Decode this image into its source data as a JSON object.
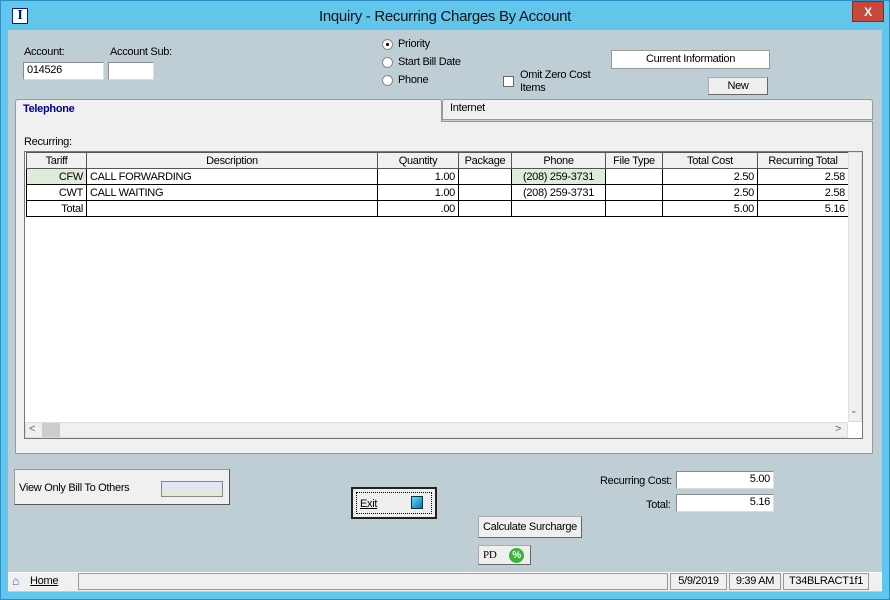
{
  "window": {
    "title": "Inquiry - Recurring Charges By Account",
    "close": "X",
    "app_icon": "I"
  },
  "form": {
    "account_label": "Account:",
    "account_value": "014526",
    "account_sub_label": "Account Sub:",
    "account_sub_value": "",
    "sort_options": [
      {
        "label": "Priority",
        "selected": true
      },
      {
        "label": "Start Bill Date",
        "selected": false
      },
      {
        "label": "Phone",
        "selected": false
      }
    ],
    "omit_zero_label": "Omit Zero Cost Items",
    "omit_zero_checked": false,
    "current_info": "Current Information",
    "new_button": "New"
  },
  "tabs": [
    {
      "label": "Telephone",
      "active": true
    },
    {
      "label": "Internet",
      "active": false
    }
  ],
  "recurring_label": "Recurring:",
  "table": {
    "columns": [
      "Tariff",
      "Description",
      "Quantity",
      "Package",
      "Phone",
      "File Type",
      "Total Cost",
      "Recurring Total"
    ],
    "rows": [
      [
        "CFW",
        "CALL FORWARDING",
        "1.00",
        "",
        "(208) 259-3731",
        "",
        "2.50",
        "2.58"
      ],
      [
        "CWT",
        "CALL WAITING",
        "1.00",
        "",
        "(208) 259-3731",
        "",
        "2.50",
        "2.58"
      ],
      [
        "Total",
        "",
        ".00",
        "",
        "",
        "",
        "5.00",
        "5.16"
      ]
    ]
  },
  "bottom": {
    "view_only": "View Only Bill To Others",
    "exit": "Exit",
    "recurring_cost_label": "Recurring Cost:",
    "recurring_cost": "5.00",
    "total_label": "Total:",
    "total": "5.16",
    "calc_surcharge": "Calculate Surcharge",
    "pd": "PD",
    "pd_icon": "%"
  },
  "status": {
    "home": "Home",
    "date": "5/9/2019",
    "time": "9:39 AM",
    "code": "T34BLRACT1f1"
  },
  "colors": {
    "titlebar": "#62c6ec",
    "background": "#bfcdd4",
    "tab_active_text": "#00008b",
    "row_highlight": "#e0ebd9"
  }
}
